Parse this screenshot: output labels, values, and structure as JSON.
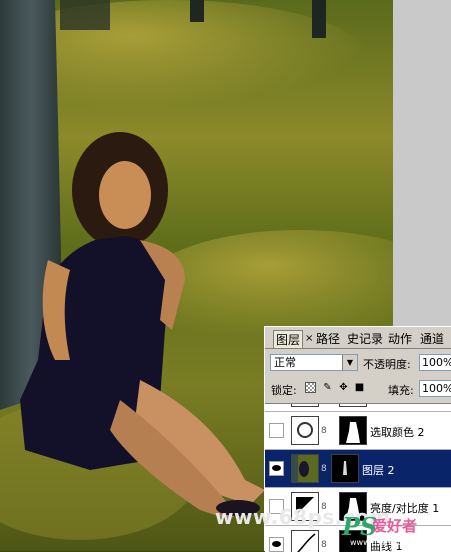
{
  "watermark": {
    "url": "www.68ps.com",
    "logo_ps": "PS",
    "logo_cn": "爱好者",
    "logo_sub": "www.psahz.com"
  },
  "layers_panel": {
    "tabs": [
      {
        "label": "图层",
        "active": true
      },
      {
        "label": "路径",
        "active": false
      },
      {
        "label": "史记录",
        "active": false
      },
      {
        "label": "动作",
        "active": false
      },
      {
        "label": "通道",
        "active": false
      }
    ],
    "close_glyph": "×",
    "blend_mode": "正常",
    "opacity_label": "不透明度:",
    "opacity_value": "100%",
    "lock_label": "锁定:",
    "fill_label": "填充:",
    "fill_value": "100%",
    "layers": [
      {
        "name": "选取颜色 2",
        "visible": false,
        "selected": false
      },
      {
        "name": "图层 2",
        "visible": true,
        "selected": true
      },
      {
        "name": "亮度/对比度 1",
        "visible": false,
        "selected": false
      },
      {
        "name": "曲线 1",
        "visible": true,
        "selected": false
      }
    ]
  }
}
